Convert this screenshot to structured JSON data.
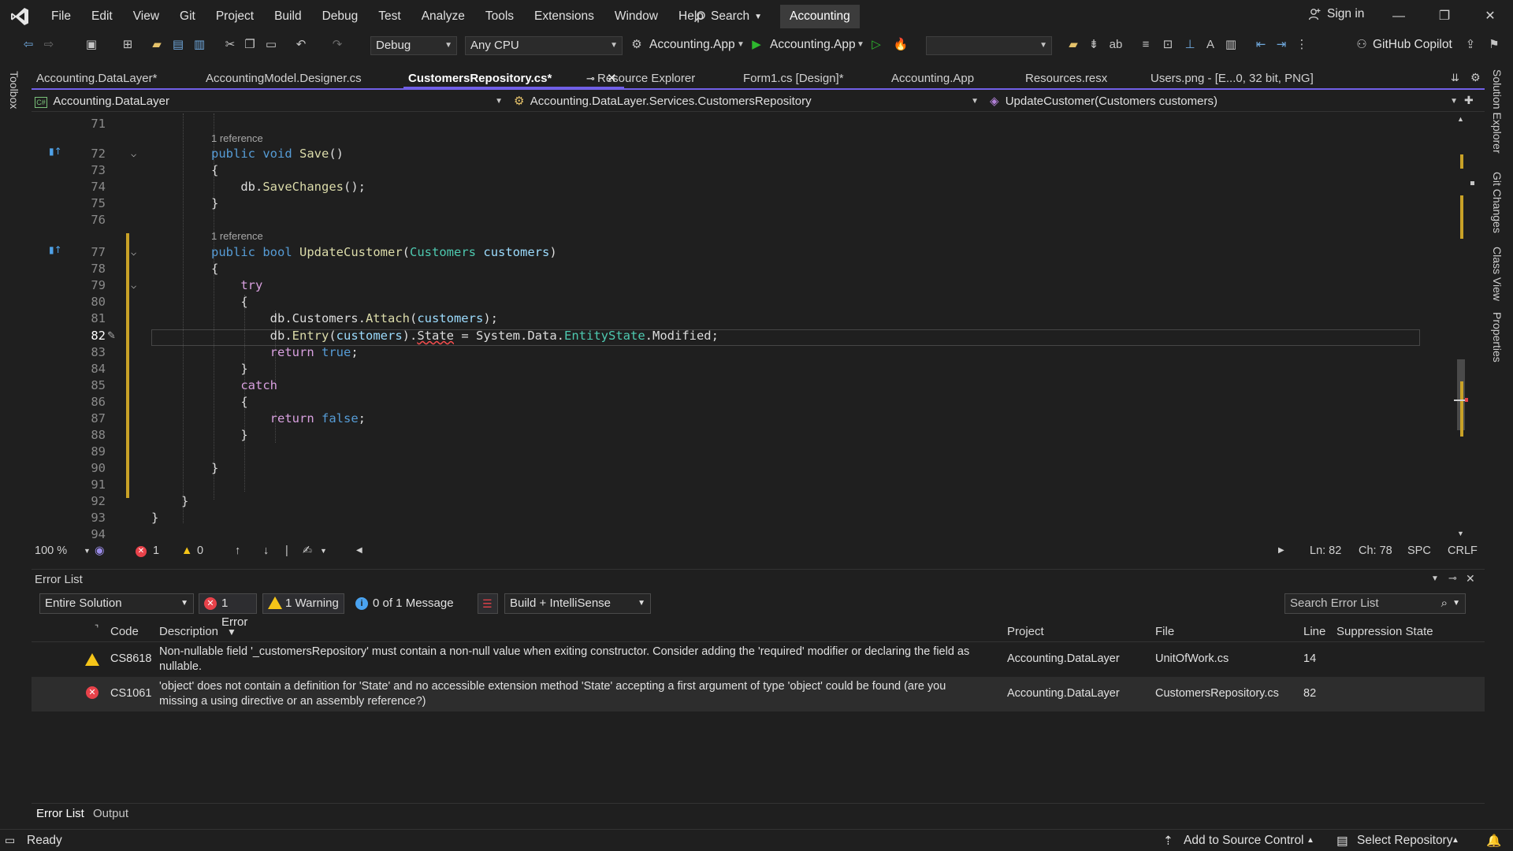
{
  "titlebar": {
    "menus": [
      "File",
      "Edit",
      "View",
      "Git",
      "Project",
      "Build",
      "Debug",
      "Test",
      "Analyze",
      "Tools",
      "Extensions",
      "Window",
      "Help"
    ],
    "search_label": "Search",
    "solution_name": "Accounting",
    "signin_label": "Sign in"
  },
  "toolbar": {
    "config": "Debug",
    "platform": "Any CPU",
    "startup_project": "Accounting.App",
    "run_target": "Accounting.App",
    "copilot_label": "GitHub Copilot"
  },
  "toolbox_label": "Toolbox",
  "right_tabs": [
    "Solution Explorer",
    "Git Changes",
    "Class View",
    "Properties"
  ],
  "tabs": [
    {
      "label": "Accounting.DataLayer*"
    },
    {
      "label": "AccountingModel.Designer.cs"
    },
    {
      "label": "CustomersRepository.cs*"
    },
    {
      "label": "Resource Explorer"
    },
    {
      "label": "Form1.cs [Design]*"
    },
    {
      "label": "Accounting.App"
    },
    {
      "label": "Resources.resx"
    },
    {
      "label": "Users.png - [E...0, 32 bit, PNG]"
    }
  ],
  "navbar": {
    "project": "Accounting.DataLayer",
    "type": "Accounting.DataLayer.Services.CustomersRepository",
    "member": "UpdateCustomer(Customers customers)"
  },
  "editor": {
    "codelens": "1 reference",
    "lines": {
      "71": "",
      "72": "",
      "73": "",
      "74": "",
      "75": "",
      "76": "",
      "77": "",
      "78": "",
      "79": "",
      "80": "",
      "81": "",
      "82": "",
      "83": "",
      "84": "",
      "85": "",
      "86": "",
      "87": "",
      "88": "",
      "89": "",
      "90": "",
      "91": "",
      "92": "",
      "93": "",
      "94": ""
    },
    "line_numbers": [
      "71",
      "72",
      "73",
      "74",
      "75",
      "76",
      "77",
      "78",
      "79",
      "80",
      "81",
      "82",
      "83",
      "84",
      "85",
      "86",
      "87",
      "88",
      "89",
      "90",
      "91",
      "92",
      "93",
      "94"
    ]
  },
  "editor_status": {
    "zoom": "100 %",
    "errors": "1",
    "warnings": "0",
    "ln": "Ln: 82",
    "ch": "Ch: 78",
    "spc": "SPC",
    "eol": "CRLF"
  },
  "error_list": {
    "title": "Error List",
    "scope": "Entire Solution",
    "errors_btn": "1 Error",
    "warnings_btn": "1 Warning",
    "messages_btn": "0 of 1 Message",
    "filter": "Build + IntelliSense",
    "search_placeholder": "Search Error List",
    "columns": [
      "Code",
      "Description",
      "Project",
      "File",
      "Line",
      "Suppression State"
    ],
    "rows": [
      {
        "severity": "warning",
        "code": "CS8618",
        "description_1": "Non-nullable field '_customersRepository' must contain a non-null value when exiting constructor. Consider adding the 'required' modifier or declaring the field as",
        "description_2": "nullable.",
        "project": "Accounting.DataLayer",
        "file": "UnitOfWork.cs",
        "line": "14"
      },
      {
        "severity": "error",
        "code": "CS1061",
        "description_1": "'object' does not contain a definition for 'State' and no accessible extension method 'State' accepting a first argument of type 'object' could be found (are you",
        "description_2": "missing a using directive or an assembly reference?)",
        "project": "Accounting.DataLayer",
        "file": "CustomersRepository.cs",
        "line": "82"
      }
    ],
    "bottom_tabs": [
      "Error List",
      "Output"
    ]
  },
  "statusbar": {
    "ready": "Ready",
    "source_control": "Add to Source Control",
    "repository": "Select Repository"
  },
  "colors": {
    "accent": "#7160e8",
    "keyword": "#569cd6",
    "control": "#d8a0df",
    "method": "#dcdcaa",
    "type": "#4ec9b0",
    "param": "#9cdcfe",
    "error": "#e8424a",
    "warning": "#f5c518"
  }
}
